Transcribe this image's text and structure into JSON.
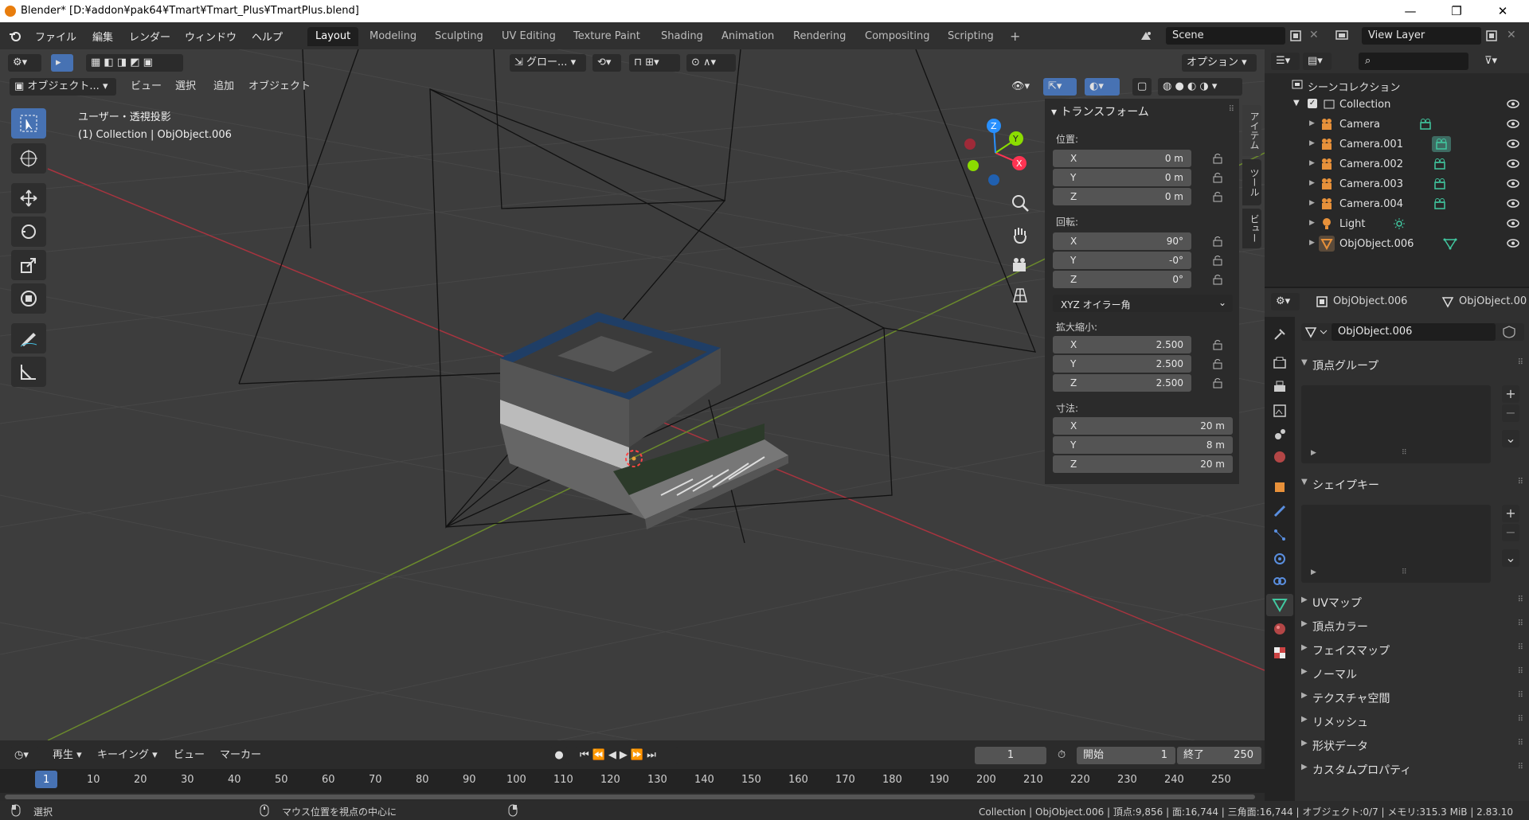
{
  "window": {
    "title": "Blender* [D:¥addon¥pak64¥Tmart¥Tmart_Plus¥TmartPlus.blend]",
    "minimize": "—",
    "maximize": "❐",
    "close": "✕"
  },
  "menu": [
    "ファイル",
    "編集",
    "レンダー",
    "ウィンドウ",
    "ヘルプ"
  ],
  "workspaces": [
    "Layout",
    "Modeling",
    "Sculpting",
    "UV Editing",
    "Texture Paint",
    "Shading",
    "Animation",
    "Rendering",
    "Compositing",
    "Scripting"
  ],
  "workspace_add": "+",
  "scene": {
    "name": "Scene",
    "view_layer": "View Layer"
  },
  "viewport": {
    "mode": "オブジェクト...",
    "menus": [
      "ビュー",
      "選択",
      "追加",
      "オブジェクト"
    ],
    "transform_orientation": "グロー...",
    "options": "オプション",
    "view_name": "ユーザー・透視投影",
    "context": "(1) Collection | ObjObject.006",
    "gizmo": {
      "x": "X",
      "y": "Y",
      "z": "Z"
    }
  },
  "npanel": {
    "header": "トランスフォーム",
    "location_label": "位置:",
    "location": [
      {
        "axis": "X",
        "value": "0 m"
      },
      {
        "axis": "Y",
        "value": "0 m"
      },
      {
        "axis": "Z",
        "value": "0 m"
      }
    ],
    "rotation_label": "回転:",
    "rotation": [
      {
        "axis": "X",
        "value": "90°"
      },
      {
        "axis": "Y",
        "value": "-0°"
      },
      {
        "axis": "Z",
        "value": "0°"
      }
    ],
    "rotation_mode": "XYZ オイラー角",
    "scale_label": "拡大縮小:",
    "scale": [
      {
        "axis": "X",
        "value": "2.500"
      },
      {
        "axis": "Y",
        "value": "2.500"
      },
      {
        "axis": "Z",
        "value": "2.500"
      }
    ],
    "dimensions_label": "寸法:",
    "dimensions": [
      {
        "axis": "X",
        "value": "20 m"
      },
      {
        "axis": "Y",
        "value": "8 m"
      },
      {
        "axis": "Z",
        "value": "20 m"
      }
    ],
    "tabs": [
      "アイテム",
      "ツール",
      "ビュー"
    ]
  },
  "outliner": {
    "root": "シーンコレクション",
    "collection": "Collection",
    "items": [
      {
        "name": "Camera",
        "kind": "camera"
      },
      {
        "name": "Camera.001",
        "kind": "camera"
      },
      {
        "name": "Camera.002",
        "kind": "camera"
      },
      {
        "name": "Camera.003",
        "kind": "camera"
      },
      {
        "name": "Camera.004",
        "kind": "camera"
      },
      {
        "name": "Light",
        "kind": "light"
      },
      {
        "name": "ObjObject.006",
        "kind": "mesh"
      }
    ]
  },
  "properties": {
    "object_name": "ObjObject.006",
    "data_name": "ObjObject.006",
    "mesh_name": "ObjObject.006",
    "vertex_groups": "頂点グループ",
    "shape_keys": "シェイプキー",
    "collapsed": [
      "UVマップ",
      "頂点カラー",
      "フェイスマップ",
      "ノーマル",
      "テクスチャ空間",
      "リメッシュ",
      "形状データ",
      "カスタムプロパティ"
    ]
  },
  "timeline": {
    "menus": [
      "再生",
      "キーイング",
      "ビュー",
      "マーカー"
    ],
    "current_frame": "1",
    "start_label": "開始",
    "start": "1",
    "end_label": "終了",
    "end": "250",
    "ticks": [
      "1",
      "10",
      "20",
      "30",
      "40",
      "50",
      "60",
      "70",
      "80",
      "90",
      "100",
      "110",
      "120",
      "130",
      "140",
      "150",
      "160",
      "170",
      "180",
      "190",
      "200",
      "210",
      "220",
      "230",
      "240",
      "250"
    ]
  },
  "status": {
    "left": "選択",
    "middle": "マウス位置を視点の中心に",
    "right": "Collection | ObjObject.006 | 頂点:9,856 | 面:16,744 | 三角面:16,744 | オブジェクト:0/7 | メモリ:315.3 MiB | 2.83.10"
  },
  "colors": {
    "accent": "#4772b3",
    "x_axis": "#ff3352",
    "y_axis": "#8bdc00",
    "z_axis": "#2890ff",
    "camera_icon": "#e8913a",
    "data_icon": "#41c8a0"
  }
}
